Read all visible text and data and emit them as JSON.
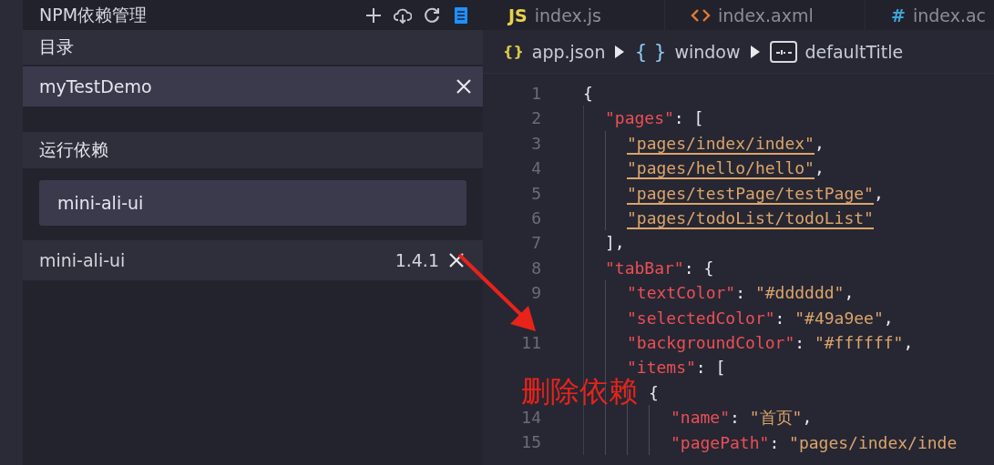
{
  "sidebar": {
    "title": "NPM依赖管理",
    "toolbar": [
      {
        "kind": "add",
        "selected": false
      },
      {
        "kind": "cloud",
        "selected": false
      },
      {
        "kind": "refresh",
        "selected": false
      },
      {
        "kind": "file",
        "selected": true
      }
    ],
    "directory_label": "目录",
    "project": {
      "name": "myTestDemo"
    },
    "runtime_label": "运行依赖",
    "search": {
      "value": "mini-ali-ui"
    },
    "dependencies": [
      {
        "name": "mini-ali-ui",
        "version": "1.4.1"
      }
    ]
  },
  "editor": {
    "tabs": [
      {
        "kind": "js",
        "badge": "JS",
        "label": "index.js"
      },
      {
        "kind": "xml",
        "label": "index.axml"
      },
      {
        "kind": "css",
        "badge": "#",
        "label": "index.ac"
      }
    ],
    "breadcrumb": [
      {
        "kind": "file",
        "icon": "{}",
        "label": "app.json"
      },
      {
        "kind": "object",
        "icon": "{ }",
        "label": "window"
      },
      {
        "kind": "string",
        "label": "defaultTitle"
      }
    ],
    "lines": [
      {
        "number": "1",
        "tokens": [
          {
            "kind": "punct",
            "text": "{"
          }
        ],
        "children": [
          {
            "number": "2",
            "tokens": [
              {
                "kind": "key",
                "text": "\"pages\""
              },
              {
                "kind": "punct",
                "text": ": ["
              }
            ],
            "children": [
              {
                "number": "3",
                "tokens": [
                  {
                    "kind": "string",
                    "text": "\"pages/index/index\"",
                    "underlined": true
                  },
                  {
                    "kind": "punct",
                    "text": ","
                  }
                ]
              },
              {
                "number": "4",
                "tokens": [
                  {
                    "kind": "string",
                    "text": "\"pages/hello/hello\"",
                    "underlined": true
                  },
                  {
                    "kind": "punct",
                    "text": ","
                  }
                ]
              },
              {
                "number": "5",
                "tokens": [
                  {
                    "kind": "string",
                    "text": "\"pages/testPage/testPage\"",
                    "underlined": true
                  },
                  {
                    "kind": "punct",
                    "text": ","
                  }
                ]
              },
              {
                "number": "6",
                "tokens": [
                  {
                    "kind": "string",
                    "text": "\"pages/todoList/todoList\"",
                    "underlined": true
                  }
                ]
              }
            ]
          },
          {
            "number": "7",
            "tokens": [
              {
                "kind": "punct",
                "text": "],"
              }
            ]
          },
          {
            "number": "8",
            "tokens": [
              {
                "kind": "key",
                "text": "\"tabBar\""
              },
              {
                "kind": "punct",
                "text": ": {"
              }
            ],
            "children": [
              {
                "number": "9",
                "tokens": [
                  {
                    "kind": "key",
                    "text": "\"textColor\""
                  },
                  {
                    "kind": "punct",
                    "text": ": "
                  },
                  {
                    "kind": "string",
                    "text": "\"#dddddd\""
                  },
                  {
                    "kind": "punct",
                    "text": ","
                  }
                ]
              },
              {
                "tokens": [
                  {
                    "kind": "key",
                    "text": "\"selectedColor\""
                  },
                  {
                    "kind": "punct",
                    "text": ": "
                  },
                  {
                    "kind": "string",
                    "text": "\"#49a9ee\""
                  },
                  {
                    "kind": "punct",
                    "text": ","
                  }
                ]
              },
              {
                "number": "11",
                "tokens": [
                  {
                    "kind": "key",
                    "text": "\"backgroundColor\""
                  },
                  {
                    "kind": "punct",
                    "text": ": "
                  },
                  {
                    "kind": "string",
                    "text": "\"#ffffff\""
                  },
                  {
                    "kind": "punct",
                    "text": ","
                  }
                ]
              },
              {
                "tokens": [
                  {
                    "kind": "key",
                    "text": "\"items\""
                  },
                  {
                    "kind": "punct",
                    "text": ": ["
                  }
                ],
                "children": [
                  {
                    "tokens": [
                      {
                        "kind": "punct",
                        "text": "{"
                      }
                    ],
                    "children": [
                      {
                        "number": "14",
                        "tokens": [
                          {
                            "kind": "key",
                            "text": "\"name\""
                          },
                          {
                            "kind": "punct",
                            "text": ": "
                          },
                          {
                            "kind": "string",
                            "text": "\"首页\""
                          },
                          {
                            "kind": "punct",
                            "text": ","
                          }
                        ]
                      },
                      {
                        "number": "15",
                        "tokens": [
                          {
                            "kind": "key",
                            "text": "\"pagePath\""
                          },
                          {
                            "kind": "punct",
                            "text": ": "
                          },
                          {
                            "kind": "string",
                            "text": "\"pages/index/inde"
                          }
                        ]
                      }
                    ]
                  }
                ]
              }
            ]
          }
        ]
      }
    ]
  },
  "annotation": {
    "text": "删除依赖"
  }
}
